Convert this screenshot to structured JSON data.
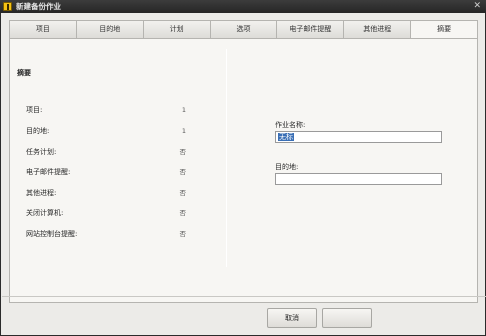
{
  "window": {
    "title": "新建备份作业",
    "close_glyph": "✕"
  },
  "tabs": [
    {
      "label": "项目"
    },
    {
      "label": "目的地"
    },
    {
      "label": "计划"
    },
    {
      "label": "选项"
    },
    {
      "label": "电子邮件提醒"
    },
    {
      "label": "其他进程"
    },
    {
      "label": "摘要",
      "active": true
    }
  ],
  "summary": {
    "heading": "摘要",
    "rows": [
      {
        "label": "项目:",
        "value": "1"
      },
      {
        "label": "目的地:",
        "value": "1"
      },
      {
        "label": "任务计划:",
        "value": "否"
      },
      {
        "label": "电子邮件提醒:",
        "value": "否"
      },
      {
        "label": "其他进程:",
        "value": "否"
      },
      {
        "label": "关闭计算机:",
        "value": "否"
      },
      {
        "label": "网站控制台提醒:",
        "value": "否"
      }
    ]
  },
  "form": {
    "job_name_label": "作业名称:",
    "job_name_value": "无标",
    "destination_label": "目的地:",
    "destination_value": ""
  },
  "buttons": {
    "cancel": "取消",
    "finish": ""
  }
}
